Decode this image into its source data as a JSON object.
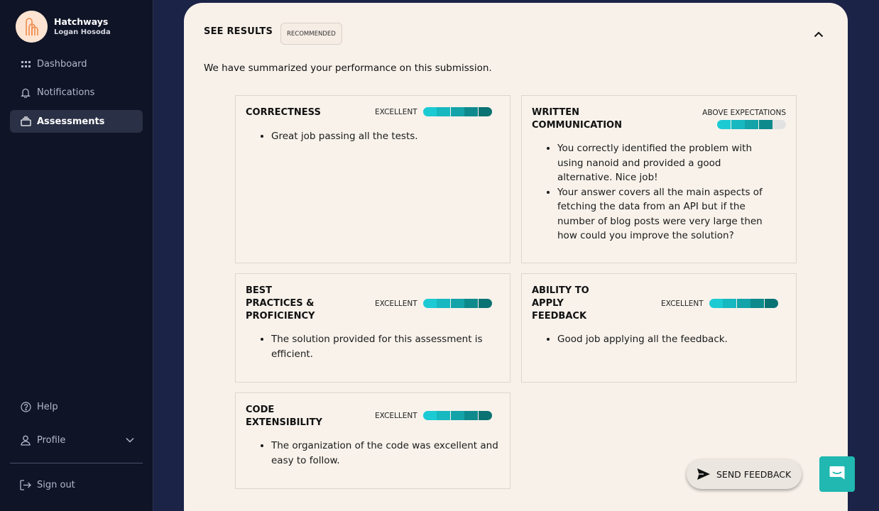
{
  "sidebar": {
    "brand_name": "Hatchways",
    "user_name": "Logan Hosoda",
    "items": [
      {
        "label": "Dashboard",
        "icon": "grid-icon"
      },
      {
        "label": "Notifications",
        "icon": "bell-icon"
      },
      {
        "label": "Assessments",
        "icon": "stack-icon",
        "active": true
      }
    ],
    "bottom_items": [
      {
        "label": "Help",
        "icon": "help-icon"
      },
      {
        "label": "Profile",
        "icon": "user-icon"
      },
      {
        "label": "Sign out",
        "icon": "sign-out-icon"
      }
    ]
  },
  "results": {
    "title": "SEE RESULTS",
    "badge": "RECOMMENDED",
    "summary": "We have summarized your performance on this submission.",
    "categories": [
      {
        "title": "CORRECTNESS",
        "rating": "EXCELLENT",
        "filled": 5,
        "bullets": [
          "Great job passing all the tests."
        ]
      },
      {
        "title": "WRITTEN COMMUNICATION",
        "rating": "ABOVE EXPECTATIONS",
        "filled": 4,
        "bullets": [
          "You correctly identified the problem with using nanoid and provided a good alternative. Nice job!",
          "Your answer covers all the main aspects of fetching the data from an API but if the number of blog posts were very large then how could you improve the solution?"
        ]
      },
      {
        "title": "BEST PRACTICES & PROFICIENCY",
        "rating": "EXCELLENT",
        "filled": 5,
        "bullets": [
          "The solution provided for this assessment is efficient."
        ]
      },
      {
        "title": "ABILITY TO APPLY FEEDBACK",
        "rating": "EXCELLENT",
        "filled": 5,
        "bullets": [
          "Good job applying all the feedback."
        ]
      },
      {
        "title": "CODE EXTENSIBILITY",
        "rating": "EXCELLENT",
        "filled": 5,
        "bullets": [
          "The organization of the code was excellent and easy to follow."
        ]
      }
    ]
  },
  "actions": {
    "send_feedback": "SEND FEEDBACK"
  },
  "colors": {
    "sidebar_bg": "#0f1426",
    "card_bg": "#f8f1ea",
    "rating_segments": [
      "#1ccad3",
      "#17b8bf",
      "#13a3a8",
      "#0e8a8c",
      "#0a7272"
    ],
    "rating_empty": "#e2e2e2",
    "chat_button": "#20b8b0"
  }
}
